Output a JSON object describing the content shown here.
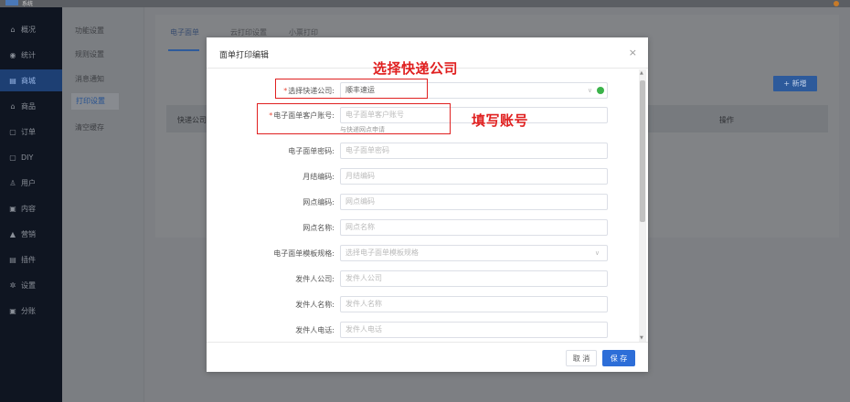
{
  "topbar": {
    "logo_text": "系统"
  },
  "sidebar": {
    "items": [
      {
        "icon": "⌂",
        "label": "概况"
      },
      {
        "icon": "◉",
        "label": "统计"
      },
      {
        "icon": "▤",
        "label": "商城"
      },
      {
        "icon": "⌂",
        "label": "商品"
      },
      {
        "icon": "▢",
        "label": "订单"
      },
      {
        "icon": "▢",
        "label": "DIY"
      },
      {
        "icon": "♙",
        "label": "用户"
      },
      {
        "icon": "▣",
        "label": "内容"
      },
      {
        "icon": "▲",
        "label": "营销"
      },
      {
        "icon": "▤",
        "label": "插件"
      },
      {
        "icon": "✲",
        "label": "设置"
      },
      {
        "icon": "▣",
        "label": "分账"
      }
    ]
  },
  "submenu": {
    "items": [
      "功能设置",
      "规则设置",
      "消息通知",
      "打印设置",
      "清空缓存"
    ]
  },
  "panel": {
    "tabs": [
      "电子面单",
      "云打印设置",
      "小票打印"
    ],
    "add_button": "+ 新增",
    "columns": [
      "快递公司",
      "操作"
    ]
  },
  "modal": {
    "title": "面单打印编辑",
    "close": "×",
    "fields": [
      {
        "label": "选择快递公司:",
        "required": true,
        "value": "顺丰速运",
        "placeholder": "",
        "select": true
      },
      {
        "label": "电子面单客户账号:",
        "required": true,
        "value": "",
        "placeholder": "电子面单客户账号",
        "select": false
      },
      {
        "label": "电子面单密码:",
        "required": false,
        "value": "",
        "placeholder": "电子面单密码",
        "select": false
      },
      {
        "label": "月结编码:",
        "required": false,
        "value": "",
        "placeholder": "月结编码",
        "select": false
      },
      {
        "label": "网点编码:",
        "required": false,
        "value": "",
        "placeholder": "网点编码",
        "select": false
      },
      {
        "label": "网点名称:",
        "required": false,
        "value": "",
        "placeholder": "网点名称",
        "select": false
      },
      {
        "label": "电子面单模板规格:",
        "required": false,
        "value": "",
        "placeholder": "选择电子面单模板规格",
        "select": true
      },
      {
        "label": "发件人公司:",
        "required": false,
        "value": "",
        "placeholder": "发件人公司",
        "select": false
      },
      {
        "label": "发件人名称:",
        "required": false,
        "value": "",
        "placeholder": "发件人名称",
        "select": false
      },
      {
        "label": "发件人电话:",
        "required": false,
        "value": "",
        "placeholder": "发件人电话",
        "select": false
      }
    ],
    "account_hint": "与快递网点申请",
    "cancel": "取 消",
    "save": "保 存"
  },
  "annotations": {
    "select_company": "选择快递公司",
    "fill_account": "填写账号"
  },
  "colors": {
    "accent": "#2d6ed8",
    "annotation": "#e02020",
    "ok": "#3bb34a"
  }
}
